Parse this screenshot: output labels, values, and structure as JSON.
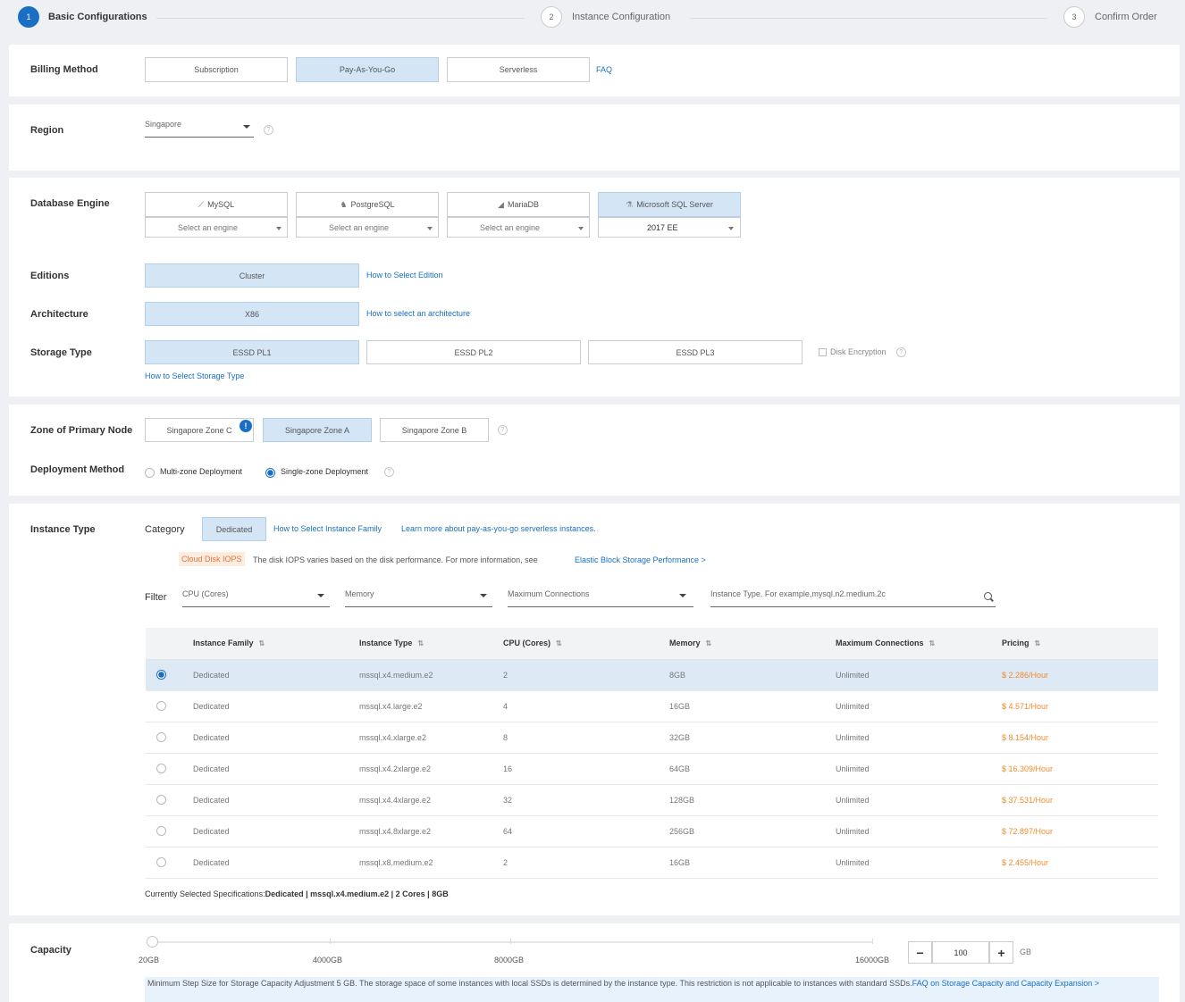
{
  "steps": [
    {
      "num": "1",
      "label": "Basic Configurations"
    },
    {
      "num": "2",
      "label": "Instance Configuration"
    },
    {
      "num": "3",
      "label": "Confirm Order"
    }
  ],
  "billing": {
    "label": "Billing Method",
    "options": [
      "Subscription",
      "Pay-As-You-Go",
      "Serverless"
    ],
    "faq": "FAQ"
  },
  "region": {
    "label": "Region",
    "value": "Singapore",
    "help": "?"
  },
  "engine": {
    "label": "Database Engine",
    "engines": [
      {
        "name": "MySQL",
        "select": "Select an engine"
      },
      {
        "name": "PostgreSQL",
        "select": "Select an engine"
      },
      {
        "name": "MariaDB",
        "select": "Select an engine"
      },
      {
        "name": "Microsoft SQL Server",
        "select": "2017 EE"
      }
    ]
  },
  "editions": {
    "label": "Editions",
    "value": "Cluster",
    "link": "How to Select Edition"
  },
  "architecture": {
    "label": "Architecture",
    "value": "X86",
    "link": "How to select an architecture"
  },
  "storage": {
    "label": "Storage Type",
    "options": [
      "ESSD PL1",
      "ESSD PL2",
      "ESSD PL3"
    ],
    "encryption": "Disk Encryption",
    "link": "How to Select Storage Type"
  },
  "zone": {
    "label": "Zone of Primary Node",
    "options": [
      "Singapore Zone C",
      "Singapore Zone A",
      "Singapore Zone B"
    ],
    "badge": "!"
  },
  "deployment": {
    "label": "Deployment Method",
    "options": [
      "Multi-zone Deployment",
      "Single-zone Deployment"
    ]
  },
  "instance": {
    "label": "Instance Type",
    "category_label": "Category",
    "category": "Dedicated",
    "link1": "How to Select Instance Family",
    "link2": "Learn more about pay-as-you-go serverless instances.",
    "iops_tag": "Cloud Disk IOPS",
    "iops_text": "The disk IOPS varies based on the disk performance. For more information, see",
    "iops_link": "Elastic Block Storage Performance >",
    "filter_label": "Filter",
    "filters": {
      "cpu": "CPU (Cores)",
      "memory": "Memory",
      "connections": "Maximum Connections",
      "search_placeholder": "Instance Type. For example,mysql.n2.medium.2c"
    },
    "columns": [
      "Instance Family",
      "Instance Type",
      "CPU (Cores)",
      "Memory",
      "Maximum Connections",
      "Pricing"
    ],
    "rows": [
      {
        "family": "Dedicated",
        "type": "mssql.x4.medium.e2",
        "cpu": "2",
        "memory": "8GB",
        "conn": "Unlimited",
        "price": "$ 2.286/Hour",
        "selected": true
      },
      {
        "family": "Dedicated",
        "type": "mssql.x4.large.e2",
        "cpu": "4",
        "memory": "16GB",
        "conn": "Unlimited",
        "price": "$ 4.571/Hour",
        "selected": false
      },
      {
        "family": "Dedicated",
        "type": "mssql.x4.xlarge.e2",
        "cpu": "8",
        "memory": "32GB",
        "conn": "Unlimited",
        "price": "$ 8.154/Hour",
        "selected": false
      },
      {
        "family": "Dedicated",
        "type": "mssql.x4.2xlarge.e2",
        "cpu": "16",
        "memory": "64GB",
        "conn": "Unlimited",
        "price": "$ 16.309/Hour",
        "selected": false
      },
      {
        "family": "Dedicated",
        "type": "mssql.x4.4xlarge.e2",
        "cpu": "32",
        "memory": "128GB",
        "conn": "Unlimited",
        "price": "$ 37.531/Hour",
        "selected": false
      },
      {
        "family": "Dedicated",
        "type": "mssql.x4.8xlarge.e2",
        "cpu": "64",
        "memory": "256GB",
        "conn": "Unlimited",
        "price": "$ 72.897/Hour",
        "selected": false
      },
      {
        "family": "Dedicated",
        "type": "mssql.x8.medium.e2",
        "cpu": "2",
        "memory": "16GB",
        "conn": "Unlimited",
        "price": "$ 2.455/Hour",
        "selected": false
      }
    ],
    "summary_prefix": "Currently Selected Specifications:",
    "summary_value": "Dedicated | mssql.x4.medium.e2 | 2 Cores | 8GB"
  },
  "capacity": {
    "label": "Capacity",
    "ticks": [
      "20GB",
      "4000GB",
      "8000GB",
      "16000GB"
    ],
    "value": "100",
    "unit": "GB",
    "minus": "−",
    "plus": "+",
    "note": "Minimum Step Size for Storage Capacity Adjustment 5 GB. The storage space of some instances with local SSDs is determined by the instance type. This restriction is not applicable to instances with standard SSDs.",
    "note_link": "FAQ on Storage Capacity and Capacity Expansion >"
  }
}
